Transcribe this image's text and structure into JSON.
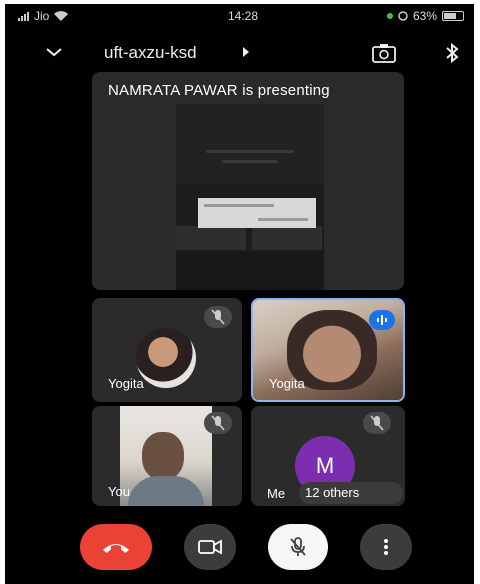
{
  "status_bar": {
    "carrier": "Jio",
    "time": "14:28",
    "battery": "63%",
    "battery_level": 0.63
  },
  "header": {
    "meeting_code": "uft-axzu-ksd",
    "icons": [
      "chevron-down-icon",
      "switch-camera-icon",
      "bluetooth-icon"
    ]
  },
  "presentation": {
    "title": "NAMRATA PAWAR is presenting",
    "fullscreen_icon": "fullscreen-icon"
  },
  "participants": [
    {
      "name": "Yogita",
      "muted": true,
      "type": "photo-avatar"
    },
    {
      "name": "Yogita",
      "speaking": true,
      "type": "video"
    },
    {
      "name": "You",
      "muted": true,
      "type": "video"
    },
    {
      "name": "Me",
      "initial": "M",
      "others": "12 others",
      "muted": true,
      "avatar_color": "#7b2fb0"
    }
  ],
  "controls": {
    "end_call_color": "#ea4335",
    "icons": [
      "end-call-icon",
      "camera-icon",
      "mic-off-icon",
      "more-vert-icon"
    ]
  }
}
